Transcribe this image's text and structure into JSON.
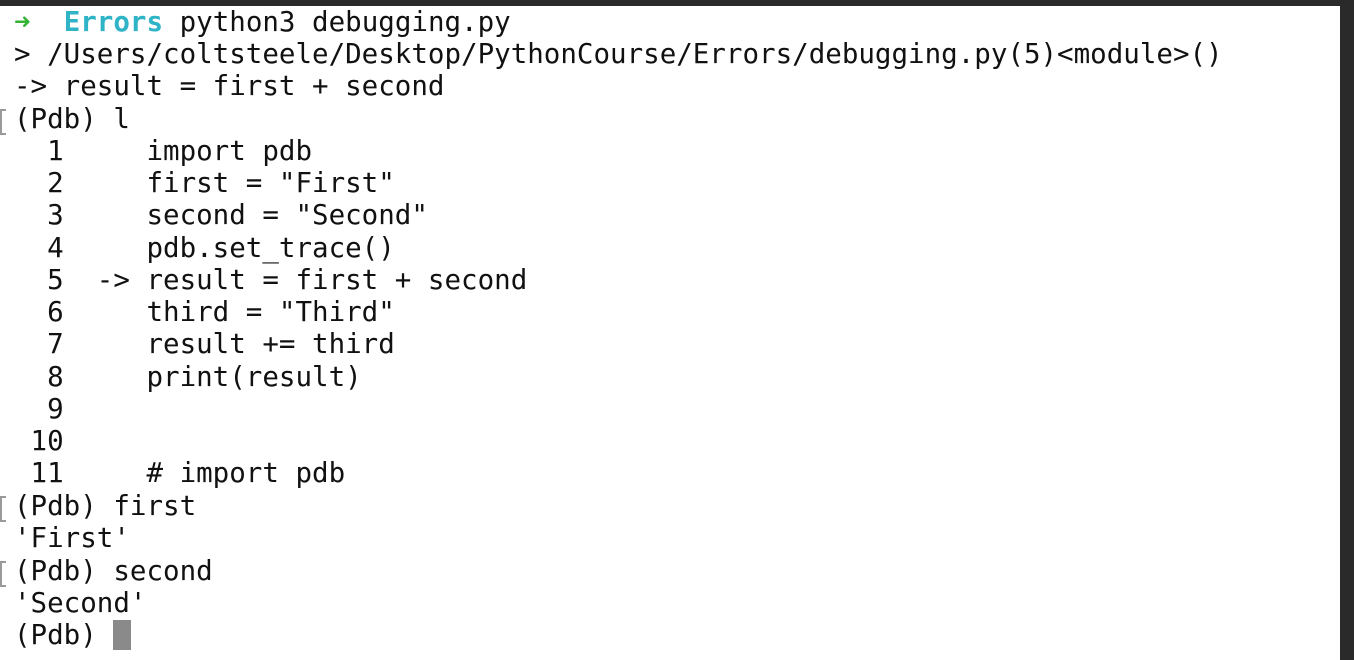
{
  "prompt": {
    "arrow": "➜",
    "directory": "Errors",
    "command": "python3 debugging.py"
  },
  "output": {
    "location": "> /Users/coltsteele/Desktop/PythonCourse/Errors/debugging.py(5)<module>()",
    "current": "-> result = first + second"
  },
  "session": [
    {
      "input": "(Pdb) l"
    },
    {
      "listing": [
        "  1     import pdb",
        "  2     first = \"First\"",
        "  3     second = \"Second\"",
        "  4     pdb.set_trace()",
        "  5  -> result = first + second",
        "  6     third = \"Third\"",
        "  7     result += third",
        "  8     print(result)",
        "  9",
        " 10",
        " 11     # import pdb"
      ]
    },
    {
      "input": "(Pdb) first",
      "result": "'First'"
    },
    {
      "input": "(Pdb) second",
      "result": "'Second'"
    }
  ],
  "final_prompt": "(Pdb) ",
  "colors": {
    "prompt_arrow": "#35b335",
    "prompt_dir": "#2eb3c7",
    "cursor": "#8a8a8a"
  }
}
